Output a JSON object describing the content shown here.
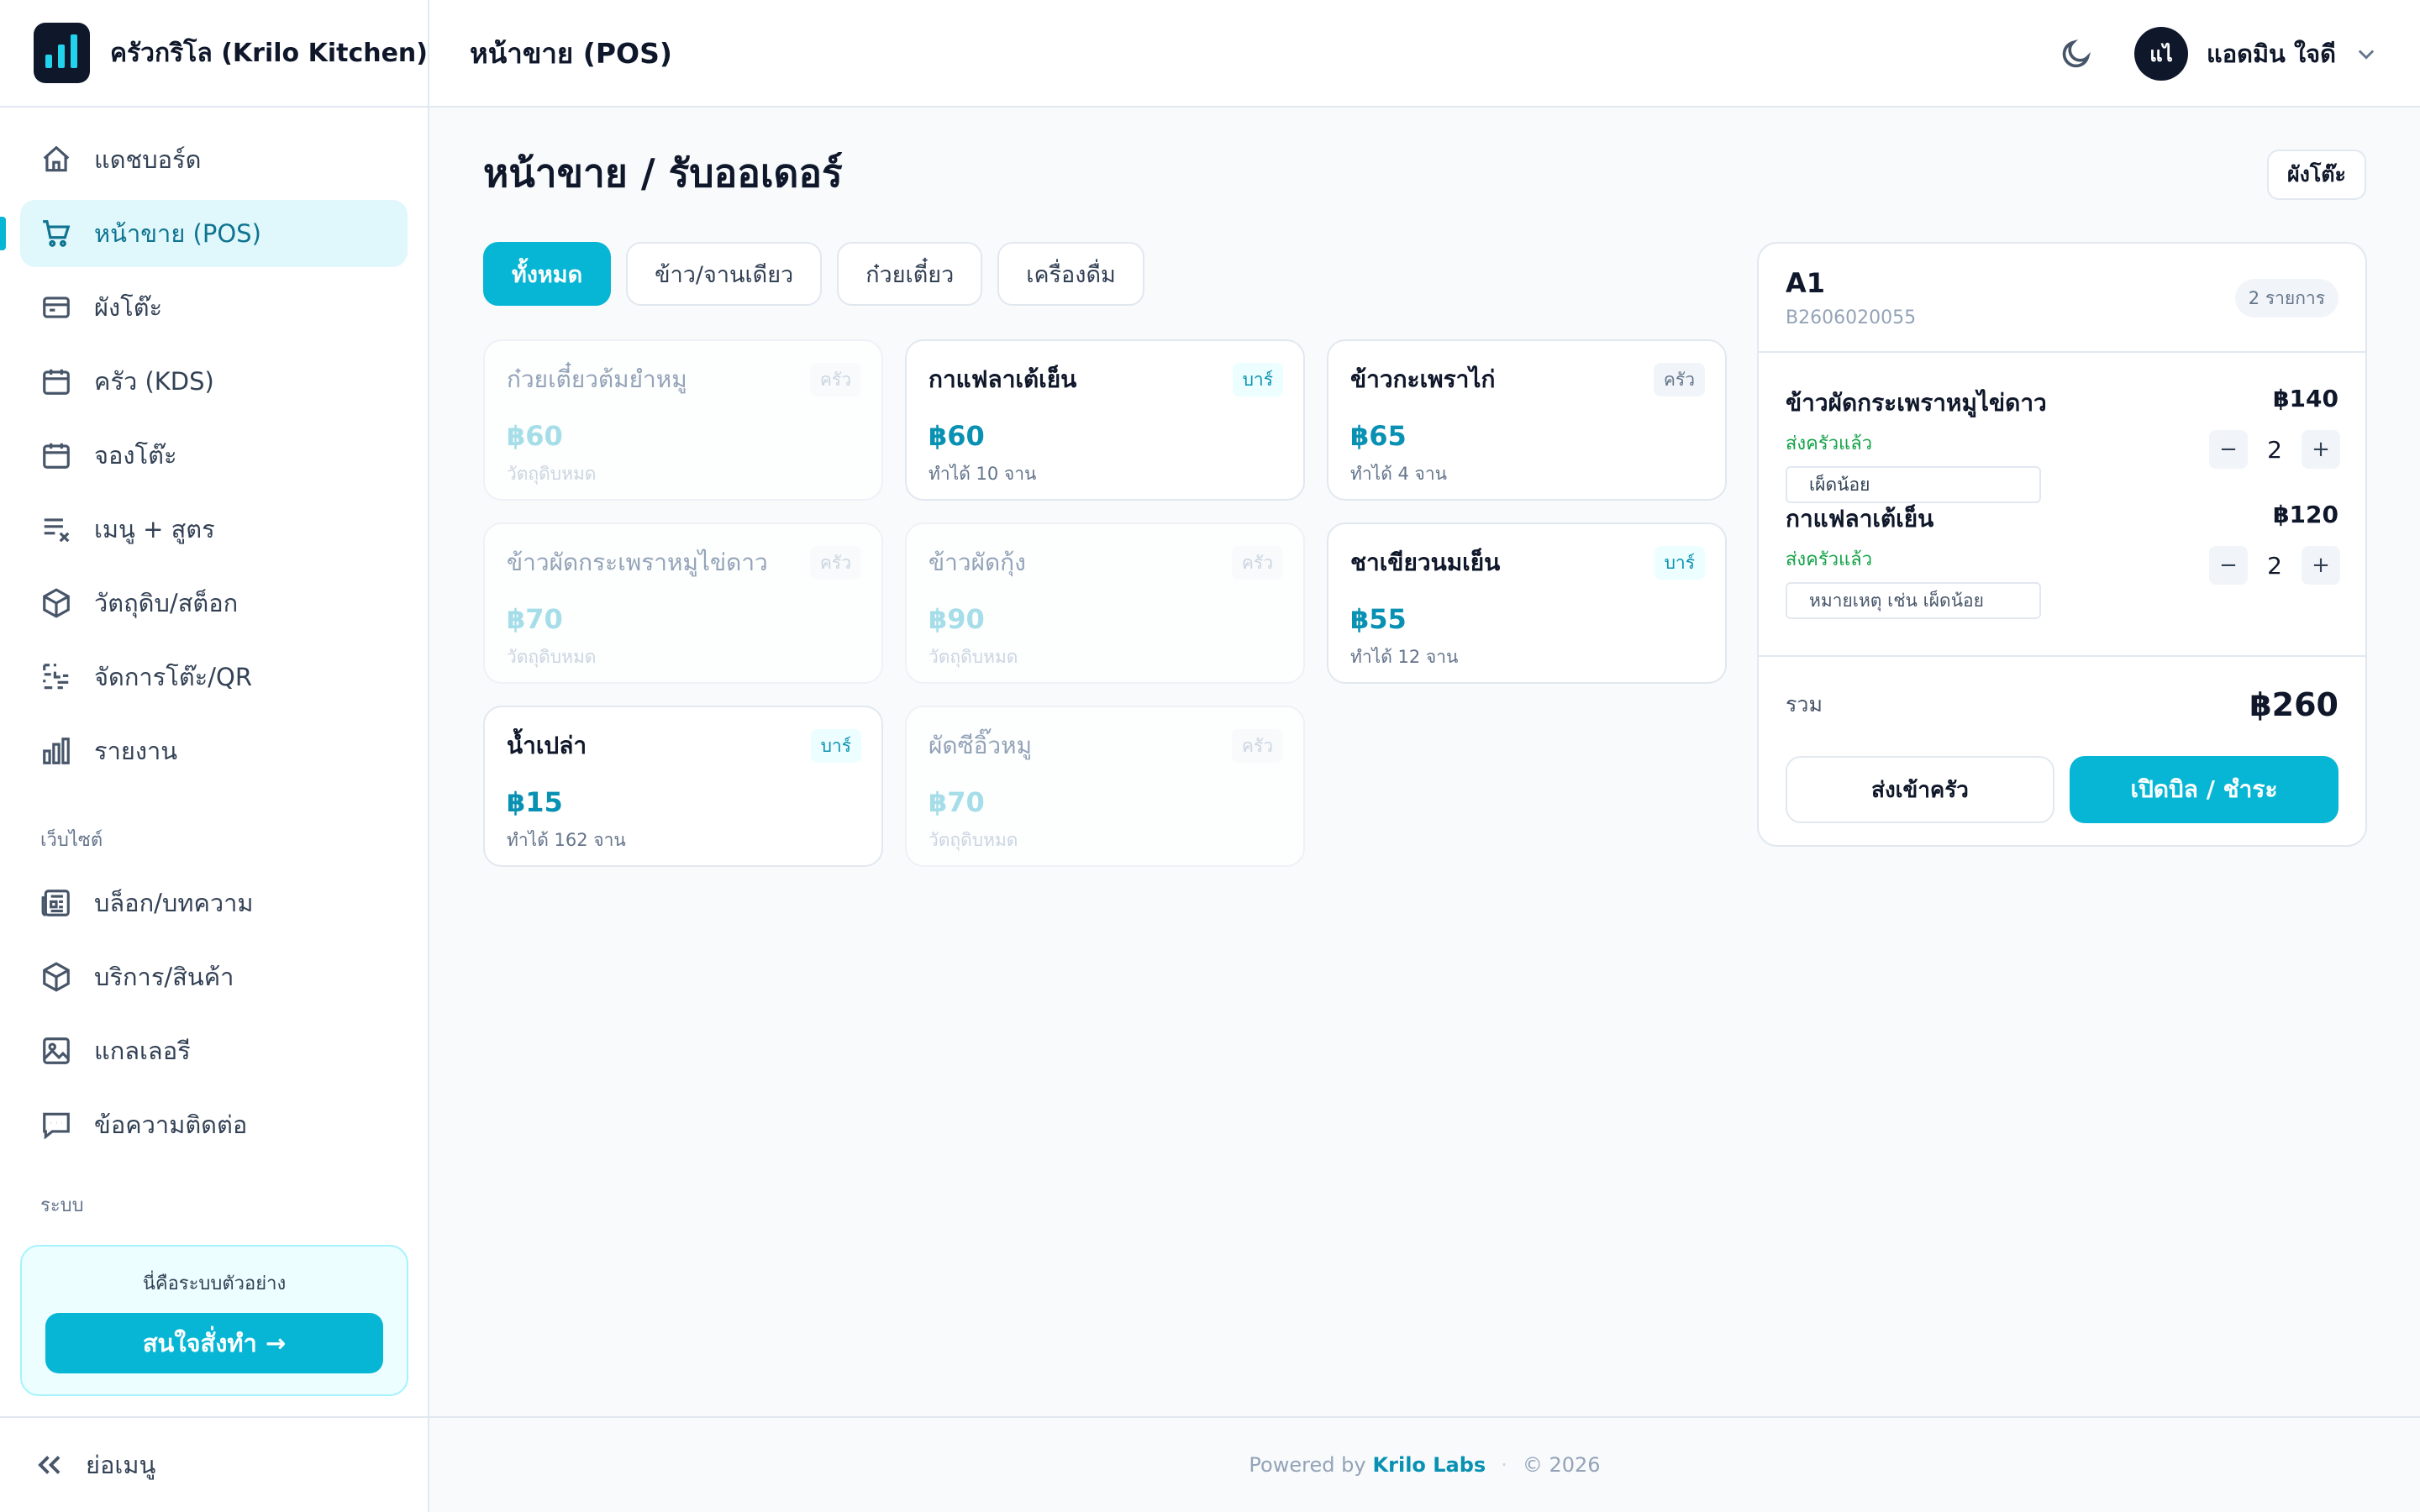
{
  "brand": {
    "name": "ครัวกริโล (Krilo Kitchen)"
  },
  "topbar": {
    "title": "หน้าขาย (POS)",
    "user_initials": "แไ",
    "user_name": "แอดมิน ใจดี"
  },
  "sidebar": {
    "items": [
      {
        "label": "แดชบอร์ด",
        "icon": "home-icon"
      },
      {
        "label": "หน้าขาย (POS)",
        "icon": "cart-icon",
        "active": true
      },
      {
        "label": "ผังโต๊ะ",
        "icon": "layout-icon"
      },
      {
        "label": "ครัว (KDS)",
        "icon": "calendar-icon"
      },
      {
        "label": "จองโต๊ะ",
        "icon": "calendar-icon"
      },
      {
        "label": "เมนู + สูตร",
        "icon": "list-x-icon"
      },
      {
        "label": "วัตถุดิบ/สต็อก",
        "icon": "box-icon"
      },
      {
        "label": "จัดการโต๊ะ/QR",
        "icon": "qr-icon"
      },
      {
        "label": "รายงาน",
        "icon": "chart-icon"
      }
    ],
    "section_website": "เว็บไซต์",
    "website_items": [
      {
        "label": "บล็อก/บทความ",
        "icon": "newspaper-icon"
      },
      {
        "label": "บริการ/สินค้า",
        "icon": "box-icon"
      },
      {
        "label": "แกลเลอรี",
        "icon": "image-icon"
      },
      {
        "label": "ข้อความติดต่อ",
        "icon": "message-icon"
      }
    ],
    "section_system": "ระบบ",
    "demo_text": "นี่คือระบบตัวอย่าง",
    "demo_button": "สนใจสั่งทำ →",
    "collapse_label": "ย่อเมนู"
  },
  "main": {
    "page_title": "หน้าขาย / รับออเดอร์",
    "layout_button": "ผังโต๊ะ",
    "tabs": [
      {
        "label": "ทั้งหมด",
        "active": true
      },
      {
        "label": "ข้าว/จานเดียว"
      },
      {
        "label": "ก๋วยเตี๋ยว"
      },
      {
        "label": "เครื่องดื่ม"
      }
    ],
    "products": [
      {
        "name": "ก๋วยเตี๋ยวต้มยำหมู",
        "station": "ครัว",
        "price": "฿60",
        "stock": "วัตถุดิบหมด",
        "available": false
      },
      {
        "name": "กาแฟลาเต้เย็น",
        "station": "บาร์",
        "price": "฿60",
        "stock": "ทำได้ 10 จาน",
        "available": true
      },
      {
        "name": "ข้าวกะเพราไก่",
        "station": "ครัว",
        "price": "฿65",
        "stock": "ทำได้ 4 จาน",
        "available": true
      },
      {
        "name": "ข้าวผัดกระเพราหมูไข่ดาว",
        "station": "ครัว",
        "price": "฿70",
        "stock": "วัตถุดิบหมด",
        "available": false
      },
      {
        "name": "ข้าวผัดกุ้ง",
        "station": "ครัว",
        "price": "฿90",
        "stock": "วัตถุดิบหมด",
        "available": false
      },
      {
        "name": "ชาเขียวนมเย็น",
        "station": "บาร์",
        "price": "฿55",
        "stock": "ทำได้ 12 จาน",
        "available": true
      },
      {
        "name": "น้ำเปล่า",
        "station": "บาร์",
        "price": "฿15",
        "stock": "ทำได้ 162 จาน",
        "available": true
      },
      {
        "name": "ผัดซีอิ๊วหมู",
        "station": "ครัว",
        "price": "฿70",
        "stock": "วัตถุดิบหมด",
        "available": false
      }
    ]
  },
  "order": {
    "table": "A1",
    "bill_no": "B2606020055",
    "count_label": "2 รายการ",
    "items": [
      {
        "name": "ข้าวผัดกระเพราหมูไข่ดาว",
        "status": "ส่งครัวแล้ว",
        "note_value": "เผ็ดน้อย",
        "note_placeholder": "หมายเหตุ เช่น เผ็ดน้อย",
        "price": "฿140",
        "qty": "2"
      },
      {
        "name": "กาแฟลาเต้เย็น",
        "status": "ส่งครัวแล้ว",
        "note_value": "",
        "note_placeholder": "หมายเหตุ เช่น เผ็ดน้อย",
        "price": "฿120",
        "qty": "2"
      }
    ],
    "minus": "−",
    "plus": "+",
    "total_label": "รวม",
    "total_value": "฿260",
    "send_kitchen": "ส่งเข้าครัว",
    "open_bill": "เปิดบิล / ชำระ"
  },
  "footer": {
    "powered": "Powered by",
    "brand": "Krilo Labs",
    "sep": "·",
    "copyright": "© 2026"
  },
  "colors": {
    "accent": "#06b6d4",
    "accent_dark": "#0891b2",
    "sent_status": "#16a34a"
  }
}
